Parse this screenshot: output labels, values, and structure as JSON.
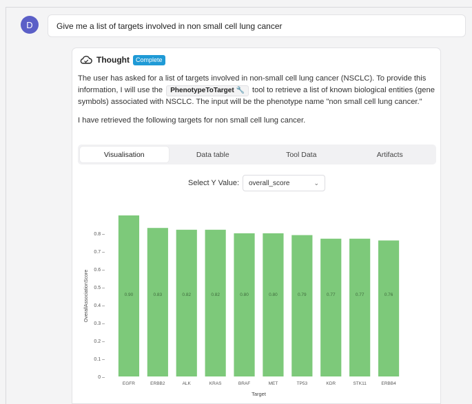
{
  "user": {
    "avatar_initial": "D",
    "message": "Give me a list of targets involved in non small cell lung cancer"
  },
  "thought": {
    "title": "Thought",
    "status": "Complete",
    "para1_before": "The user has asked for a list of targets involved in non-small cell lung cancer (NSCLC). To provide this information, I will use the",
    "tool_name": "PhenotypeToTarget",
    "para1_after": "tool to retrieve a list of known biological entities (gene symbols) associated with NSCLC. The input will be the phenotype name \"non small cell lung cancer.\"",
    "para2": "I have retrieved the following targets for non small cell lung cancer."
  },
  "tabs": [
    {
      "label": "Visualisation",
      "active": true
    },
    {
      "label": "Data table",
      "active": false
    },
    {
      "label": "Tool Data",
      "active": false
    },
    {
      "label": "Artifacts",
      "active": false
    }
  ],
  "select": {
    "label": "Select Y Value:",
    "value": "overall_score"
  },
  "colors": {
    "bar": "#7dc97a",
    "accent": "#1f9ad6",
    "avatar": "#5b5fc7"
  },
  "chart_data": {
    "type": "bar",
    "categories": [
      "EGFR",
      "ERBB2",
      "ALK",
      "KRAS",
      "BRAF",
      "MET",
      "TP53",
      "KDR",
      "STK11",
      "ERBB4"
    ],
    "values": [
      0.9,
      0.83,
      0.82,
      0.82,
      0.8,
      0.8,
      0.79,
      0.77,
      0.77,
      0.76
    ],
    "value_labels": [
      "0.90",
      "0.83",
      "0.82",
      "0.82",
      "0.80",
      "0.80",
      "0.79",
      "0.77",
      "0.77",
      "0.76"
    ],
    "xlabel": "Target",
    "ylabel": "OverallAssociationScore",
    "ylim": [
      0,
      0.9
    ],
    "yticks": [
      0,
      0.1,
      0.2,
      0.3,
      0.4,
      0.5,
      0.6,
      0.7,
      0.8
    ],
    "ytick_labels": [
      "0 –",
      "0.1 –",
      "0.2 –",
      "0.3 –",
      "0.4 –",
      "0.5 –",
      "0.6 –",
      "0.7 –",
      "0.8 –"
    ],
    "grid": false,
    "legend": "none"
  }
}
